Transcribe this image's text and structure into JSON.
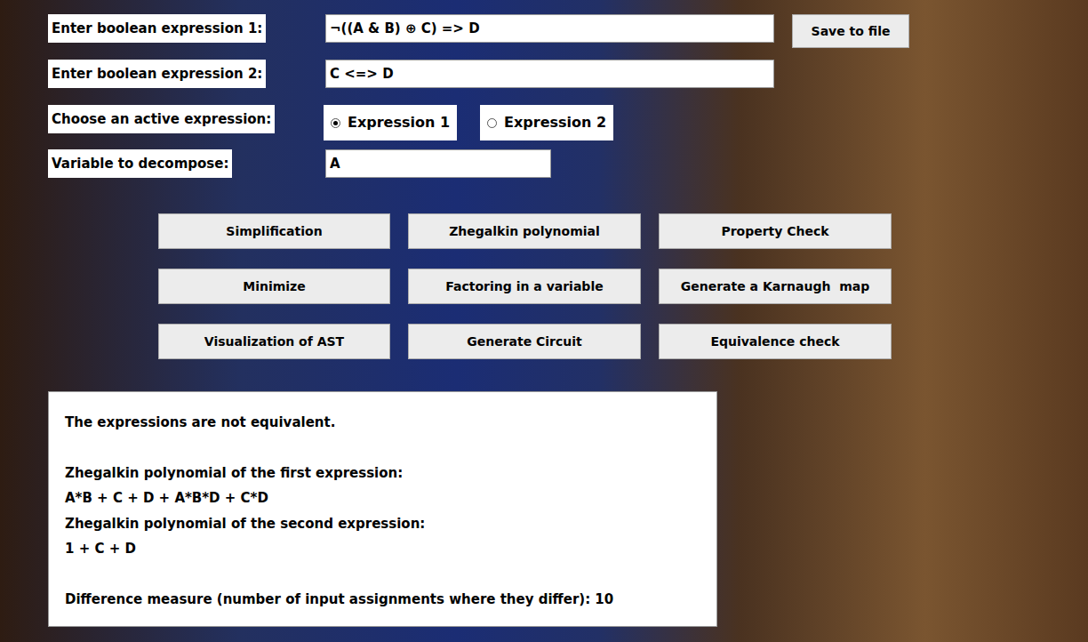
{
  "expressions": [
    {
      "label": "Enter boolean expression 1:",
      "value": "¬((A & B) ⊕ C) => D"
    },
    {
      "label": "Enter boolean expression 2:",
      "value": "C <=> D"
    }
  ],
  "save_button": "Save to file",
  "active": {
    "label": "Choose an active expression:",
    "options": [
      {
        "label": "Expression 1",
        "selected": true
      },
      {
        "label": "Expression 2",
        "selected": false
      }
    ]
  },
  "variable": {
    "label": "Variable to decompose:",
    "value": "A"
  },
  "buttons": [
    "Simplification",
    "Zhegalkin polynomial",
    "Property Check",
    "Minimize",
    "Factoring in a variable",
    "Generate a Karnaugh  map",
    "Visualization of AST",
    "Generate Circuit",
    "Equivalence check"
  ],
  "output": {
    "blocks": [
      [
        "The expressions are not equivalent."
      ],
      [
        "Zhegalkin polynomial of the first expression:",
        "A*B + C + D + A*B*D + C*D",
        "Zhegalkin polynomial of the second expression:",
        "1 + C + D"
      ],
      [
        "Difference measure (number of input assignments where they differ): 10"
      ]
    ]
  }
}
